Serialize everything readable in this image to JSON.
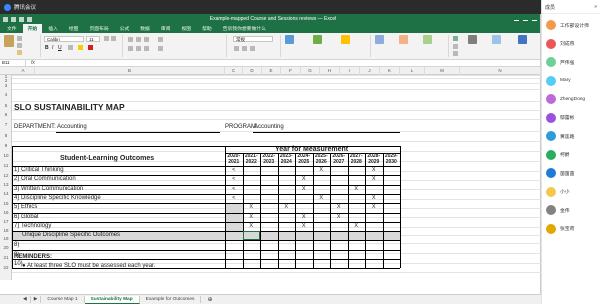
{
  "meeting": {
    "title": "腾讯会议",
    "app_badge": "会议"
  },
  "excel": {
    "doc_title": "Example-mapped Course and Sessions reviews — Excel",
    "tabs": [
      "文件",
      "开始",
      "插入",
      "绘图",
      "页面布局",
      "公式",
      "数据",
      "审阅",
      "视图",
      "帮助",
      "告诉我你想要做什么"
    ],
    "active_tab_index": 1,
    "font_name": "Calibri",
    "font_size": "11",
    "number_format": "常规",
    "ribbon_groups": [
      "剪贴板",
      "字体",
      "对齐方式",
      "数字",
      "条件格式",
      "套用表格格式",
      "单元格样式",
      "插入",
      "删除",
      "格式",
      "排序和筛选",
      "查找和选择"
    ],
    "name_box": "B11",
    "columns": [
      "A",
      "B",
      "C",
      "D",
      "E",
      "F",
      "G",
      "H",
      "I",
      "J",
      "K",
      "L",
      "M",
      "N"
    ],
    "rows": [
      "1",
      "2",
      "3",
      "4",
      "5",
      "6",
      "7",
      "8",
      "9",
      "10",
      "11",
      "12",
      "13",
      "14",
      "15",
      "16",
      "17",
      "18",
      "19",
      "20",
      "21",
      "22"
    ],
    "sheet": {
      "title": "SLO SUSTAINABILITY MAP",
      "department_label": "DEPARTMENT:",
      "department_value": "Accounting",
      "program_label": "PROGRAM:",
      "program_value": "Accounting",
      "slo_header": "Student-Learning Outcomes",
      "years_header": "Year for Measurement",
      "year_cols": [
        "2020-2021",
        "2021-2022",
        "2022-2023",
        "2023-2024",
        "2024-2025",
        "2025-2026",
        "2026-2027",
        "2027-2028",
        "2028-2029",
        "2029-2030"
      ],
      "outcomes": [
        {
          "num": "1)",
          "label": "Critical Thinking"
        },
        {
          "num": "2)",
          "label": "Oral Communication"
        },
        {
          "num": "3)",
          "label": "Written Communication"
        },
        {
          "num": "4)",
          "label": "Discipline Specific Knowledge"
        },
        {
          "num": "5)",
          "label": "Ethics"
        },
        {
          "num": "6)",
          "label": "Global"
        },
        {
          "num": "7)",
          "label": "Technology"
        }
      ],
      "unique_header": "Unique Discipline Specific Outcomes",
      "unique_rows": [
        "8)",
        "9)",
        "10)"
      ],
      "reminders_label": "REMINDERS:",
      "reminder_text": "●  At least three SLO must be assessed each year."
    },
    "sheet_tabs": [
      "Course Map 1",
      "Sustainability Map",
      "Example for Outcomes"
    ],
    "active_sheet_index": 1
  },
  "participants": {
    "header": "成员",
    "people": [
      "工作部设计师",
      "刘成燕",
      "芦伟强",
      "Mary",
      "ZhengDong",
      "鄢蕾彬",
      "黄莲路",
      "柯爵",
      "菌菌菌",
      "小小",
      "金伟",
      "张宝荷"
    ]
  }
}
